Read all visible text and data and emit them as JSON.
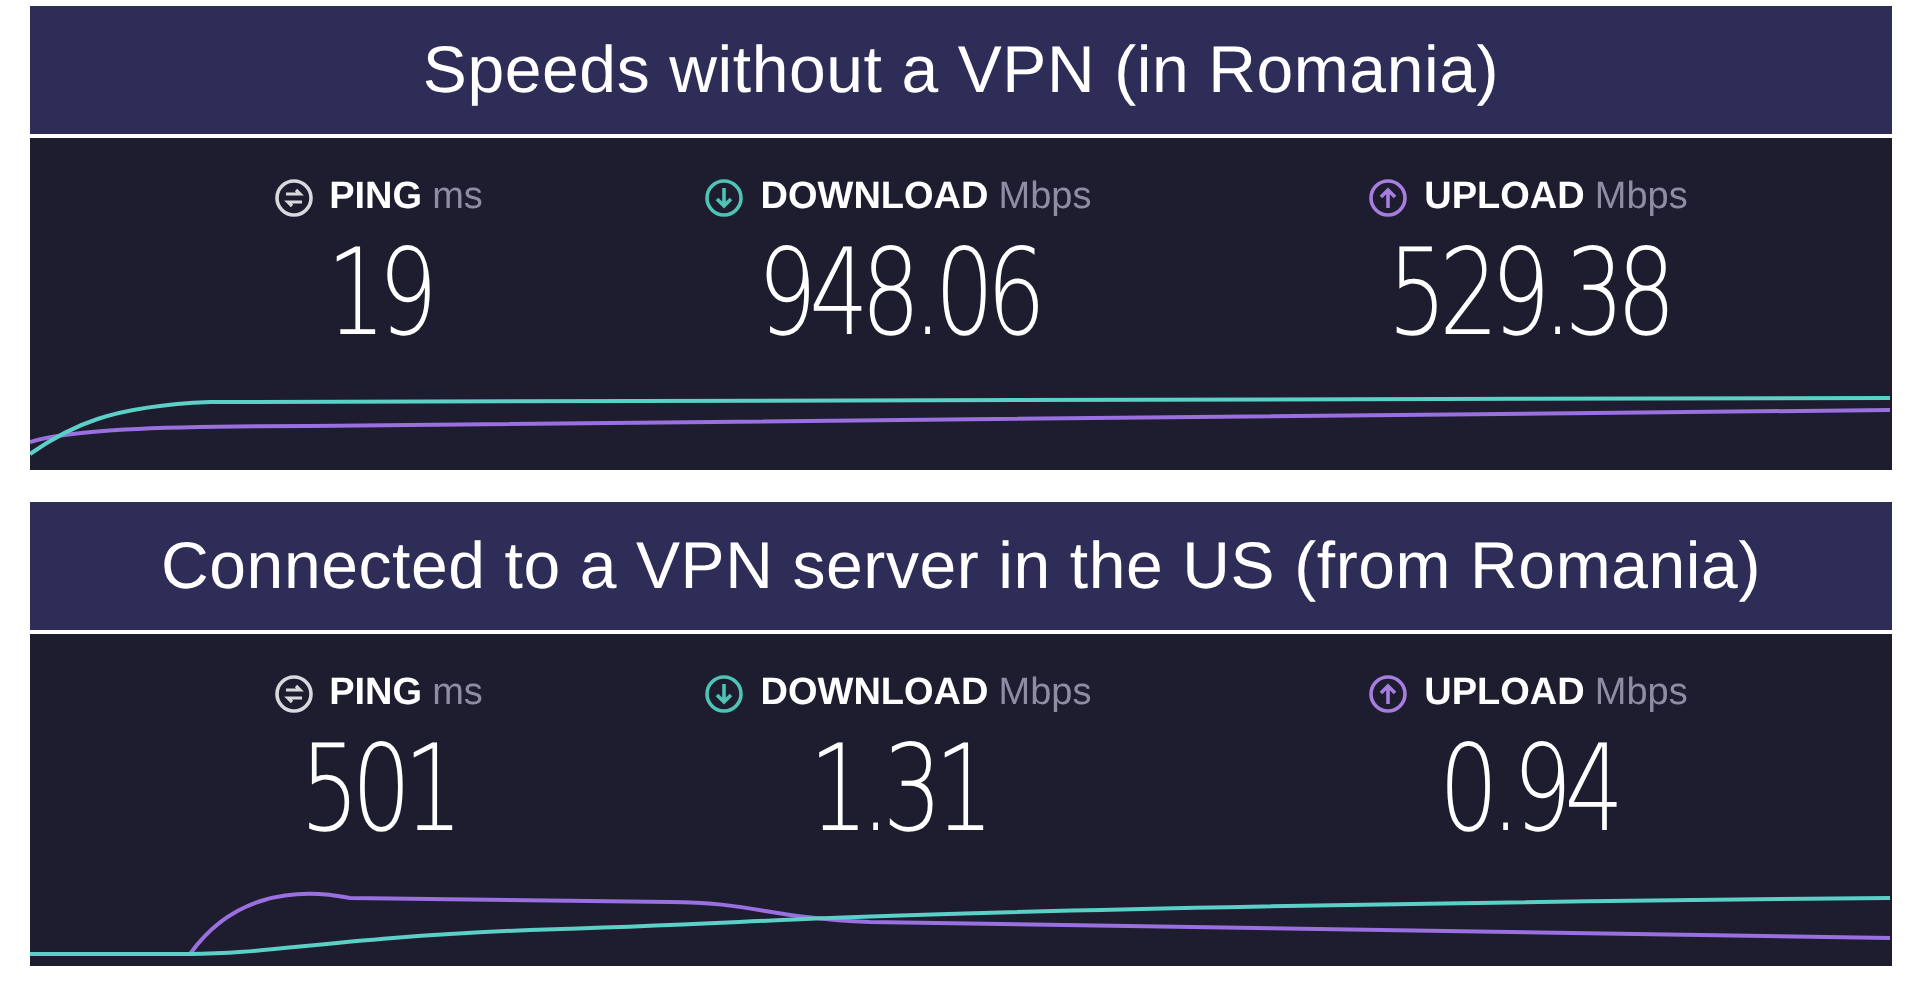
{
  "panels": [
    {
      "caption": "Speeds without a VPN (in Romania)",
      "metrics": [
        {
          "kind": "ping",
          "label": "PING",
          "unit": "ms",
          "value": "19"
        },
        {
          "kind": "download",
          "label": "DOWNLOAD",
          "unit": "Mbps",
          "value": "948.06"
        },
        {
          "kind": "upload",
          "label": "UPLOAD",
          "unit": "Mbps",
          "value": "529.38"
        }
      ]
    },
    {
      "caption": "Connected to a VPN server in the US (from Romania)",
      "metrics": [
        {
          "kind": "ping",
          "label": "PING",
          "unit": "ms",
          "value": "501"
        },
        {
          "kind": "download",
          "label": "DOWNLOAD",
          "unit": "Mbps",
          "value": "1.31"
        },
        {
          "kind": "upload",
          "label": "UPLOAD",
          "unit": "Mbps",
          "value": "0.94"
        }
      ]
    }
  ]
}
